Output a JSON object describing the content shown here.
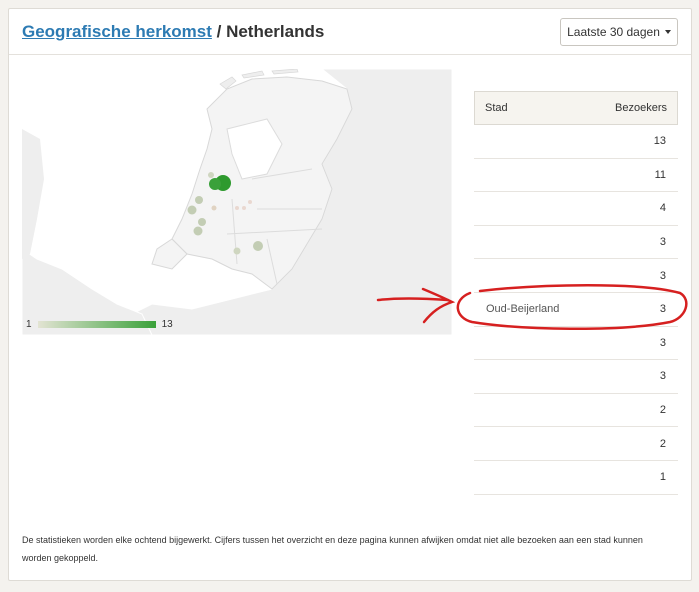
{
  "header": {
    "title_link": "Geografische herkomst",
    "title_separator": " / ",
    "title_country": "Netherlands",
    "range_button": "Laatste 30 dagen",
    "range_icon": "caret-down-icon"
  },
  "legend": {
    "min": "1",
    "max": "13",
    "colors": {
      "low": "#e3e4d3",
      "high": "#3aa13a"
    }
  },
  "table": {
    "col_city": "Stad",
    "col_visitors": "Bezoekers",
    "rows": [
      {
        "city": "",
        "visitors": "13"
      },
      {
        "city": "",
        "visitors": "11"
      },
      {
        "city": "",
        "visitors": "4"
      },
      {
        "city": "",
        "visitors": "3"
      },
      {
        "city": "",
        "visitors": "3"
      },
      {
        "city": "Oud-Beijerland",
        "visitors": "3"
      },
      {
        "city": "",
        "visitors": "3"
      },
      {
        "city": "",
        "visitors": "3"
      },
      {
        "city": "",
        "visitors": "2"
      },
      {
        "city": "",
        "visitors": "2"
      },
      {
        "city": "",
        "visitors": "1"
      }
    ]
  },
  "annotation": {
    "color": "#d62020"
  },
  "footnote": "De statistieken worden elke ochtend bijgewerkt. Cijfers tussen het overzicht en deze pagina kunnen afwijken omdat niet alle bezoeken aan een stad kunnen worden gekoppeld."
}
